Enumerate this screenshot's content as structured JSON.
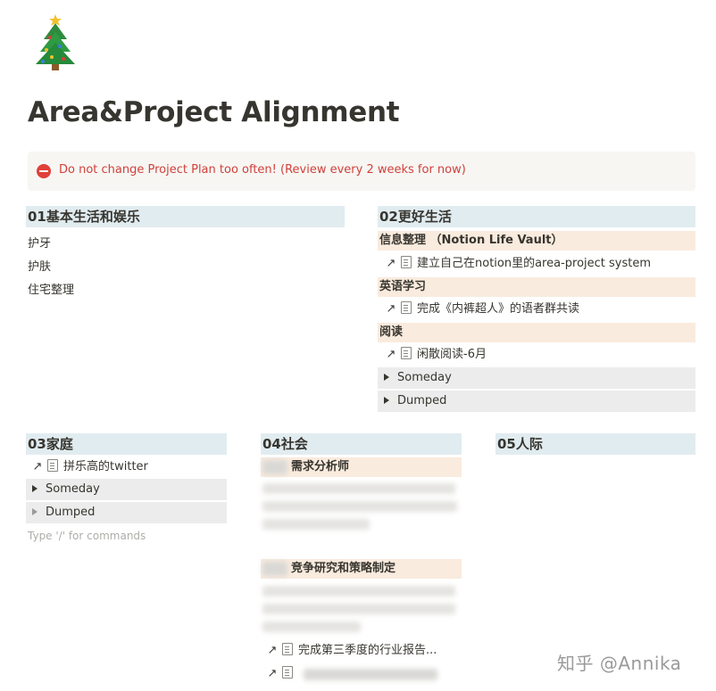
{
  "page": {
    "icon": "christmas-tree-icon",
    "title": "Area&Project Alignment"
  },
  "callout": {
    "icon": "no-entry-icon",
    "text": "Do not change Project Plan too often! (Review every 2 weeks for now)"
  },
  "col1": {
    "heading": "01基本生活和娱乐",
    "items": [
      "护牙",
      "护肤",
      "住宅整理"
    ]
  },
  "col2": {
    "heading": "02更好生活",
    "groups": [
      {
        "title": "信息整理 （Notion Life Vault）",
        "link": "建立自己在notion里的area-project system"
      },
      {
        "title": "英语学习",
        "link": "完成《内裤超人》的语者群共读"
      },
      {
        "title": "阅读",
        "link": "闲散阅读-6月"
      }
    ],
    "toggles": [
      "Someday",
      "Dumped"
    ]
  },
  "col3": {
    "heading": "03家庭",
    "link": "拼乐高的twitter",
    "toggles": [
      "Someday",
      "Dumped"
    ],
    "hint": "Type '/' for commands"
  },
  "col4": {
    "heading": "04社会",
    "groups": [
      {
        "title": "需求分析师"
      },
      {
        "title": "竞争研究和策略制定"
      }
    ],
    "links": [
      "完成第三季度的行业报告..."
    ]
  },
  "col5": {
    "heading": "05人际"
  },
  "watermark": "知乎 @Annika",
  "colors": {
    "heading_bg": "#e1ecf0",
    "subheading_bg": "#f9ebde",
    "toggle_bg": "#ececed",
    "callout_bg": "#f7f6f3",
    "callout_text": "#d1403b"
  }
}
